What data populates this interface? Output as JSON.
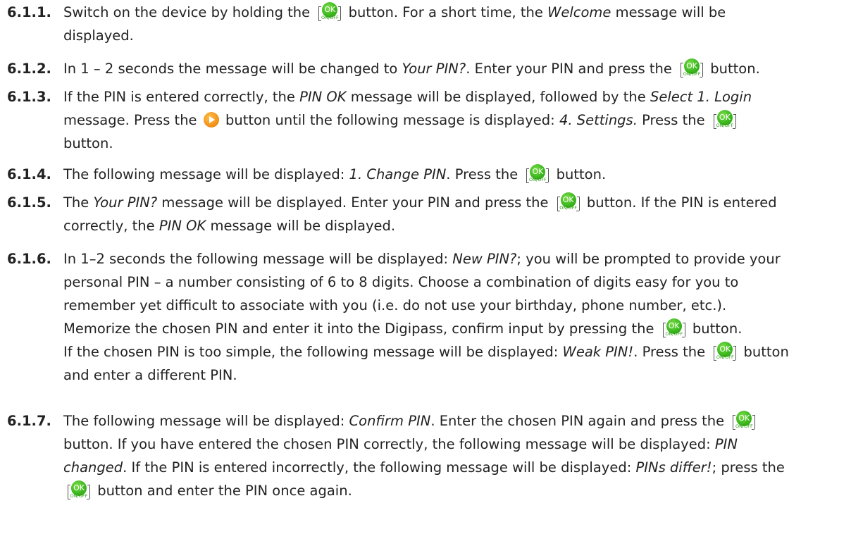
{
  "steps": [
    {
      "number": "6.1.1.",
      "lines": [
        [
          {
            "t": "Switch on the device by holding the "
          },
          {
            "btn": "ok"
          },
          {
            "t": " button. For a short time, the "
          },
          {
            "i": "Welcome"
          },
          {
            "t": " message will be"
          }
        ],
        [
          {
            "t": "displayed."
          }
        ]
      ]
    },
    {
      "number": "6.1.2.",
      "lines": [
        [
          {
            "t": "In 1 – 2 seconds the message will be changed to "
          },
          {
            "i": "Your PIN?"
          },
          {
            "t": ". Enter your PIN and press the "
          },
          {
            "btn": "ok"
          },
          {
            "t": " button."
          }
        ]
      ]
    },
    {
      "number": "6.1.3.",
      "lines": [
        [
          {
            "t": "If the PIN is entered correctly, the "
          },
          {
            "i": "PIN OK"
          },
          {
            "t": " message will be displayed, followed by the "
          },
          {
            "i": "Select 1. Login"
          }
        ],
        [
          {
            "t": "message. Press the "
          },
          {
            "btn": "play"
          },
          {
            "t": " button until the following message is displayed: "
          },
          {
            "i": "4. Settings."
          },
          {
            "t": " Press the "
          },
          {
            "btn": "ok"
          }
        ],
        [
          {
            "t": "button."
          }
        ]
      ]
    },
    {
      "number": "6.1.4.",
      "lines": [
        [
          {
            "t": "The following message will be displayed: "
          },
          {
            "i": "1. Change PIN"
          },
          {
            "t": ". Press the "
          },
          {
            "btn": "ok"
          },
          {
            "t": " button."
          }
        ]
      ]
    },
    {
      "number": "6.1.5.",
      "lines": [
        [
          {
            "t": "The "
          },
          {
            "i": "Your PIN?"
          },
          {
            "t": " message will be displayed. Enter your PIN and press the "
          },
          {
            "btn": "ok"
          },
          {
            "t": " button. If the PIN is entered"
          }
        ],
        [
          {
            "t": "correctly, the "
          },
          {
            "i": "PIN OK"
          },
          {
            "t": " message will be displayed."
          }
        ]
      ]
    },
    {
      "number": "6.1.6.",
      "lines": [
        [
          {
            "t": "In 1–2 seconds the following message will be displayed: "
          },
          {
            "i": "New PIN?"
          },
          {
            "t": "; you will be prompted to provide your"
          }
        ],
        [
          {
            "t": "personal PIN – a number consisting of 6 to 8 digits. Choose a combination of digits easy for you to"
          }
        ],
        [
          {
            "t": "remember yet difficult to associate with you (i.e. do not use your birthday, phone number, etc.)."
          }
        ],
        [
          {
            "t": "Memorize the chosen PIN and enter it into the Digipass, confirm input by pressing the "
          },
          {
            "btn": "ok"
          },
          {
            "t": " button."
          }
        ],
        [
          {
            "t": "If the chosen PIN is too simple, the following message will be displayed: "
          },
          {
            "i": "Weak PIN!"
          },
          {
            "t": ". Press the "
          },
          {
            "btn": "ok"
          },
          {
            "t": " button"
          }
        ],
        [
          {
            "t": "and enter a different PIN."
          }
        ]
      ]
    },
    {
      "number": "6.1.7.",
      "lines": [
        [
          {
            "t": "The following message will be displayed: "
          },
          {
            "i": "Confirm PIN"
          },
          {
            "t": ". Enter the chosen PIN again and press the "
          },
          {
            "btn": "ok"
          }
        ],
        [
          {
            "t": "button. If you have entered the chosen PIN correctly, the following message will be displayed: "
          },
          {
            "i": "PIN"
          }
        ],
        [
          {
            "i": "changed"
          },
          {
            "t": ". If the PIN is entered incorrectly, the following message will be displayed: "
          },
          {
            "i": "PINs differ!"
          },
          {
            "t": "; press the"
          }
        ],
        [
          {
            "btn": "ok"
          },
          {
            "t": " button and enter the PIN once again."
          }
        ]
      ]
    }
  ],
  "icons": {
    "ok": {
      "label": "OK",
      "sublabel": "ON/OFF",
      "color": "#3cb81f"
    },
    "play": {
      "color": "#f3931a"
    }
  }
}
